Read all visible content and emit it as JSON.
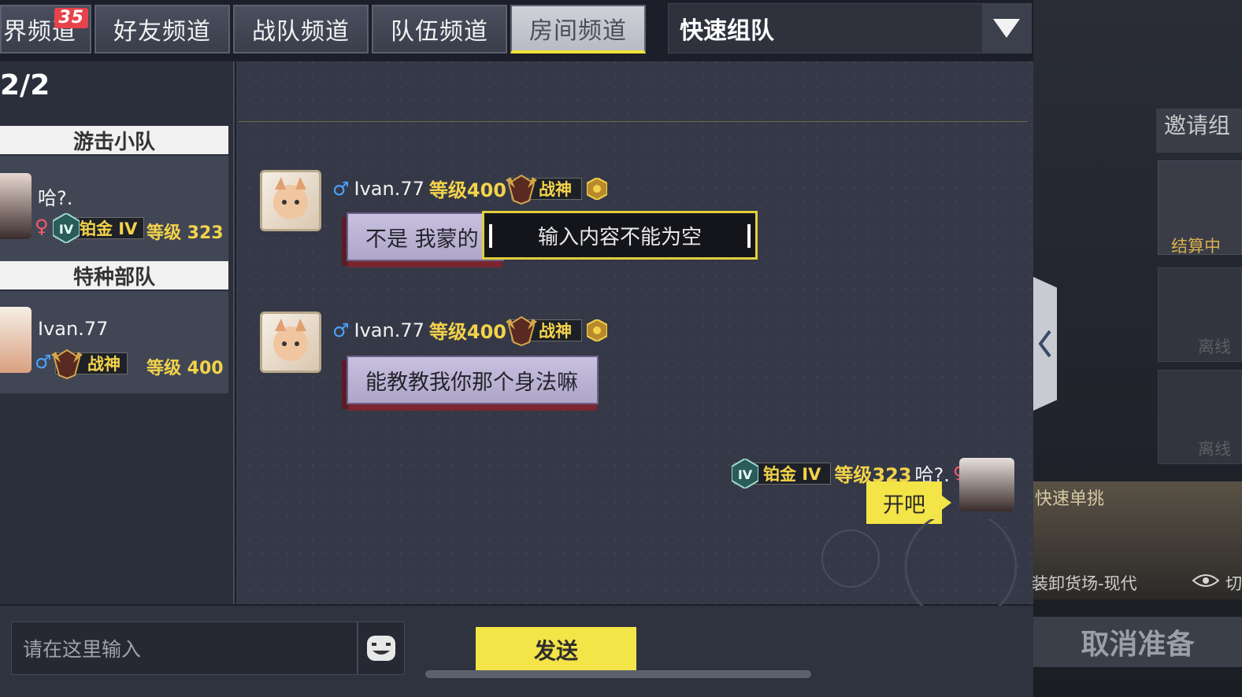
{
  "tabs": [
    {
      "label": "界频道",
      "badge": "35"
    },
    {
      "label": "好友频道"
    },
    {
      "label": "战队频道"
    },
    {
      "label": "队伍频道"
    },
    {
      "label": "房间频道",
      "active": true
    }
  ],
  "quick_team": {
    "label": "快速组队"
  },
  "room_count": "2/2",
  "squads": [
    {
      "name": "游击小队",
      "member": {
        "name": "哈?.",
        "rank": "铂金 IV",
        "level": "等级 323",
        "gender": "female"
      }
    },
    {
      "name": "特种部队",
      "member": {
        "name": "Ivan.77",
        "rank": "战神",
        "level": "等级 400",
        "gender": "male"
      }
    }
  ],
  "messages": [
    {
      "sender": "Ivan.77",
      "level": "等级400",
      "title": "战神",
      "text": "不是 我蒙的"
    },
    {
      "sender": "Ivan.77",
      "level": "等级400",
      "title": "战神",
      "text": "能教教我你那个身法嘛"
    }
  ],
  "my_message": {
    "rank": "铂金 IV",
    "level": "等级323",
    "sender": "哈?.",
    "text": "开吧"
  },
  "toast": "输入内容不能为空",
  "input": {
    "placeholder": "请在这里输入"
  },
  "send_label": "发送",
  "right": {
    "invite": "邀请组",
    "card1": "结算中",
    "card2": "离线",
    "card3": "离线",
    "map_title": "快速单挑",
    "map_name": "装卸货场-现代",
    "map_extra": "切",
    "cancel_ready": "取消准备"
  },
  "colors": {
    "accent": "#f3e447",
    "gold": "#f3d34a",
    "male": "#4aa3ff",
    "female": "#ff5a6a"
  },
  "icons": [
    "dropdown-arrow-icon",
    "mic-muted-icon",
    "speaker-icon",
    "friends-icon",
    "emoji-icon",
    "collapse-arrow-icon",
    "eye-icon"
  ]
}
